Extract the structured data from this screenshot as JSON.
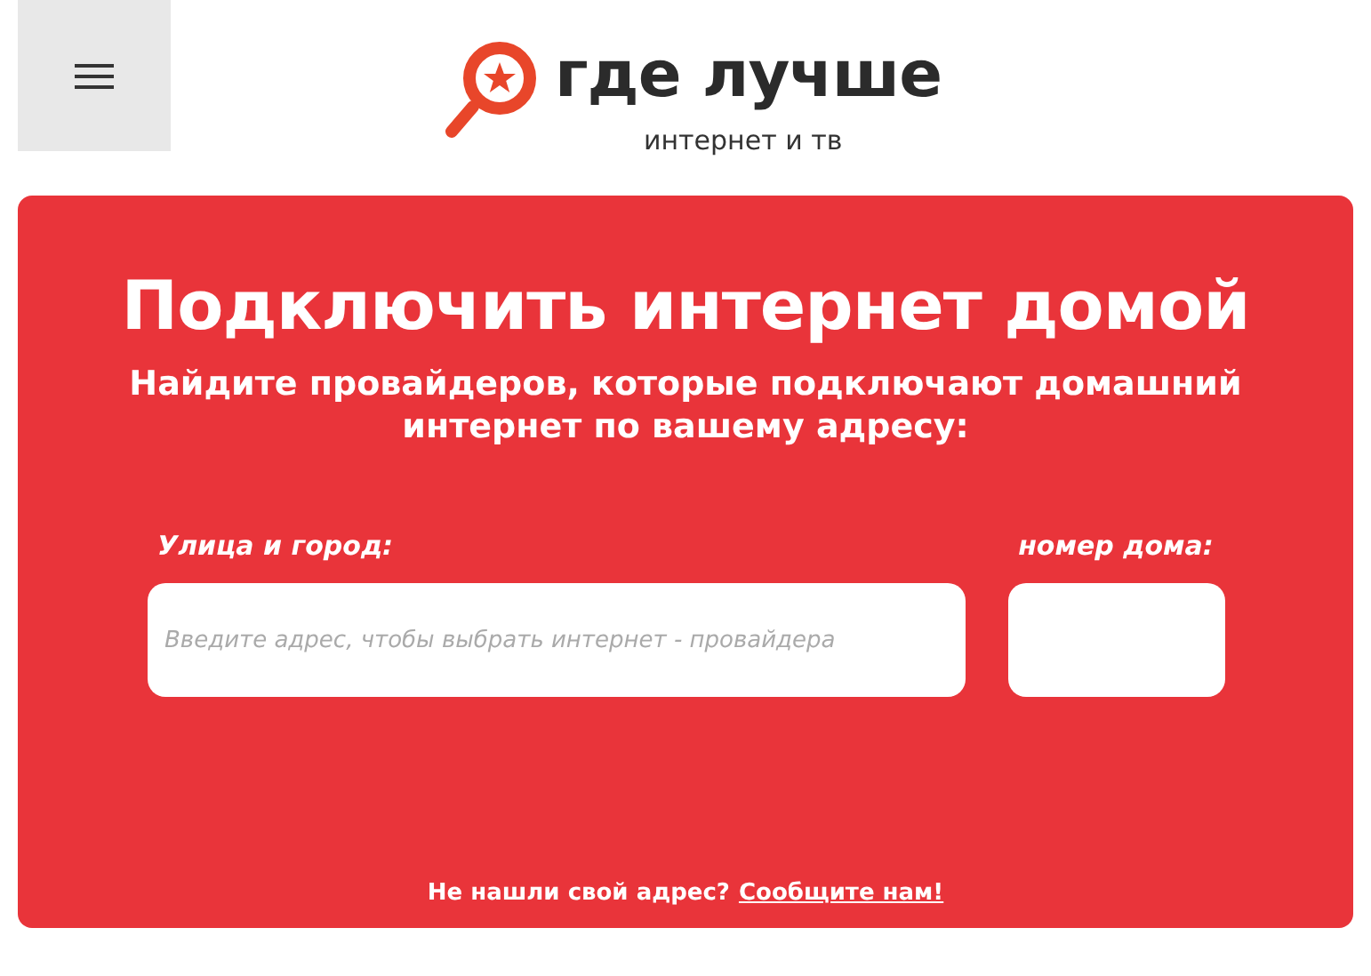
{
  "header": {
    "logo_text": "где лучше",
    "tagline": "интернет и тв"
  },
  "hero": {
    "title": "Подключить интернет домой",
    "subtitle": "Найдите провайдеров, которые подключают домашний интернет по вашему адресу:",
    "street_label": "Улица и город:",
    "street_placeholder": "Введите адрес, чтобы выбрать интернет - провайдера",
    "house_label": "номер дома:",
    "footer_text": "Не нашли свой адрес?",
    "footer_link": "Сообщите нам!"
  }
}
